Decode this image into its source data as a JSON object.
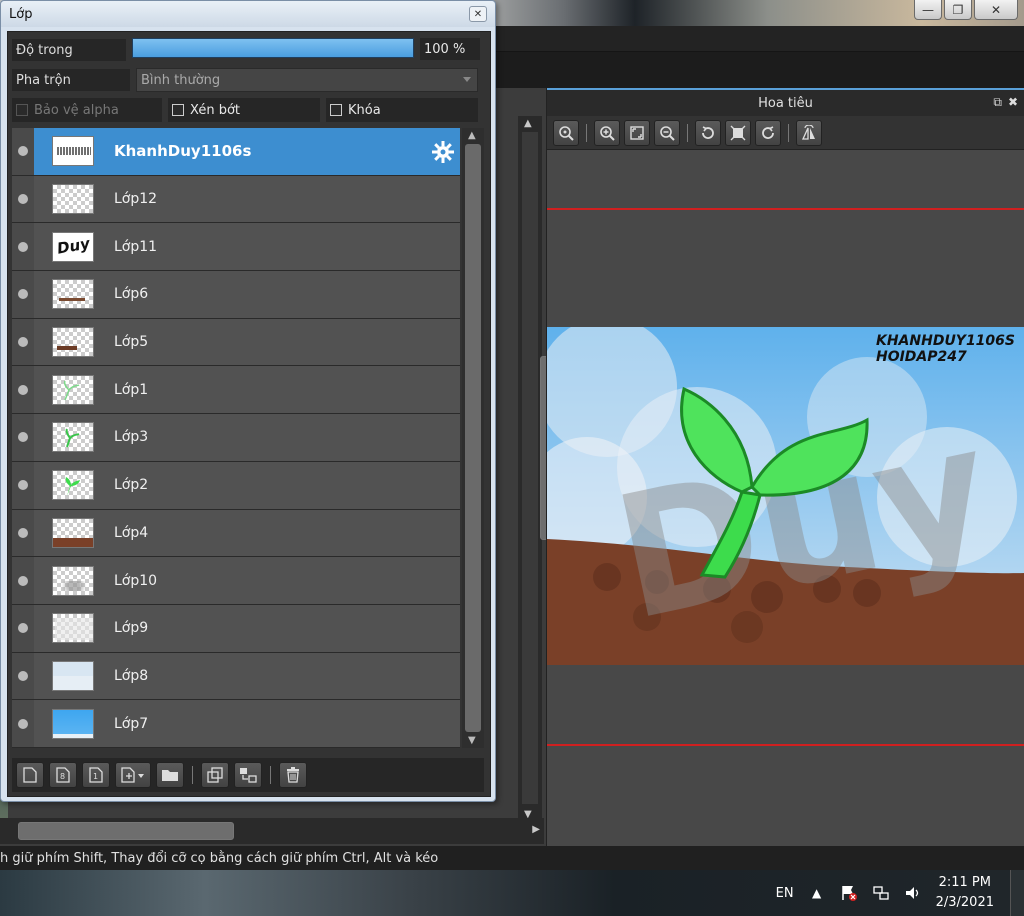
{
  "window_controls": {
    "minimize": "—",
    "restore": "❐",
    "close": "✕"
  },
  "layer_panel": {
    "title": "Lớp",
    "opacity_label": "Độ trong",
    "opacity_value": "100 %",
    "opacity_fraction": 1.0,
    "blend_label": "Pha trộn",
    "blend_value": "Bình thường",
    "protect_alpha_label": "Bảo vệ alpha",
    "clipping_label": "Xén bớt",
    "lock_label": "Khóa",
    "layers": [
      {
        "name": "KhanhDuy1106s",
        "selected": true
      },
      {
        "name": "Lớp12"
      },
      {
        "name": "Lớp11"
      },
      {
        "name": "Lớp6"
      },
      {
        "name": "Lớp5"
      },
      {
        "name": "Lớp1"
      },
      {
        "name": "Lớp3"
      },
      {
        "name": "Lớp2"
      },
      {
        "name": "Lớp4"
      },
      {
        "name": "Lớp10"
      },
      {
        "name": "Lớp9"
      },
      {
        "name": "Lớp8"
      },
      {
        "name": "Lớp7"
      }
    ],
    "thumb_text_duy": "Duy"
  },
  "navigator": {
    "title": "Hoa tiêu",
    "preview_text_line1": "KHANHDUY1106S",
    "preview_text_line2": "HOIDAP247",
    "watermark": "Duy"
  },
  "statusbar": {
    "text": "h giữ phím Shift, Thay đổi cỡ cọ bằng cách giữ phím Ctrl, Alt và kéo"
  },
  "taskbar": {
    "lang": "EN",
    "time": "2:11 PM",
    "date": "2/3/2021"
  },
  "colors": {
    "accent": "#3d8ed0",
    "sky": "#6fb8ea",
    "soil": "#7a4028",
    "leaf": "#3ddc4c",
    "nav_line": "#d02020"
  }
}
